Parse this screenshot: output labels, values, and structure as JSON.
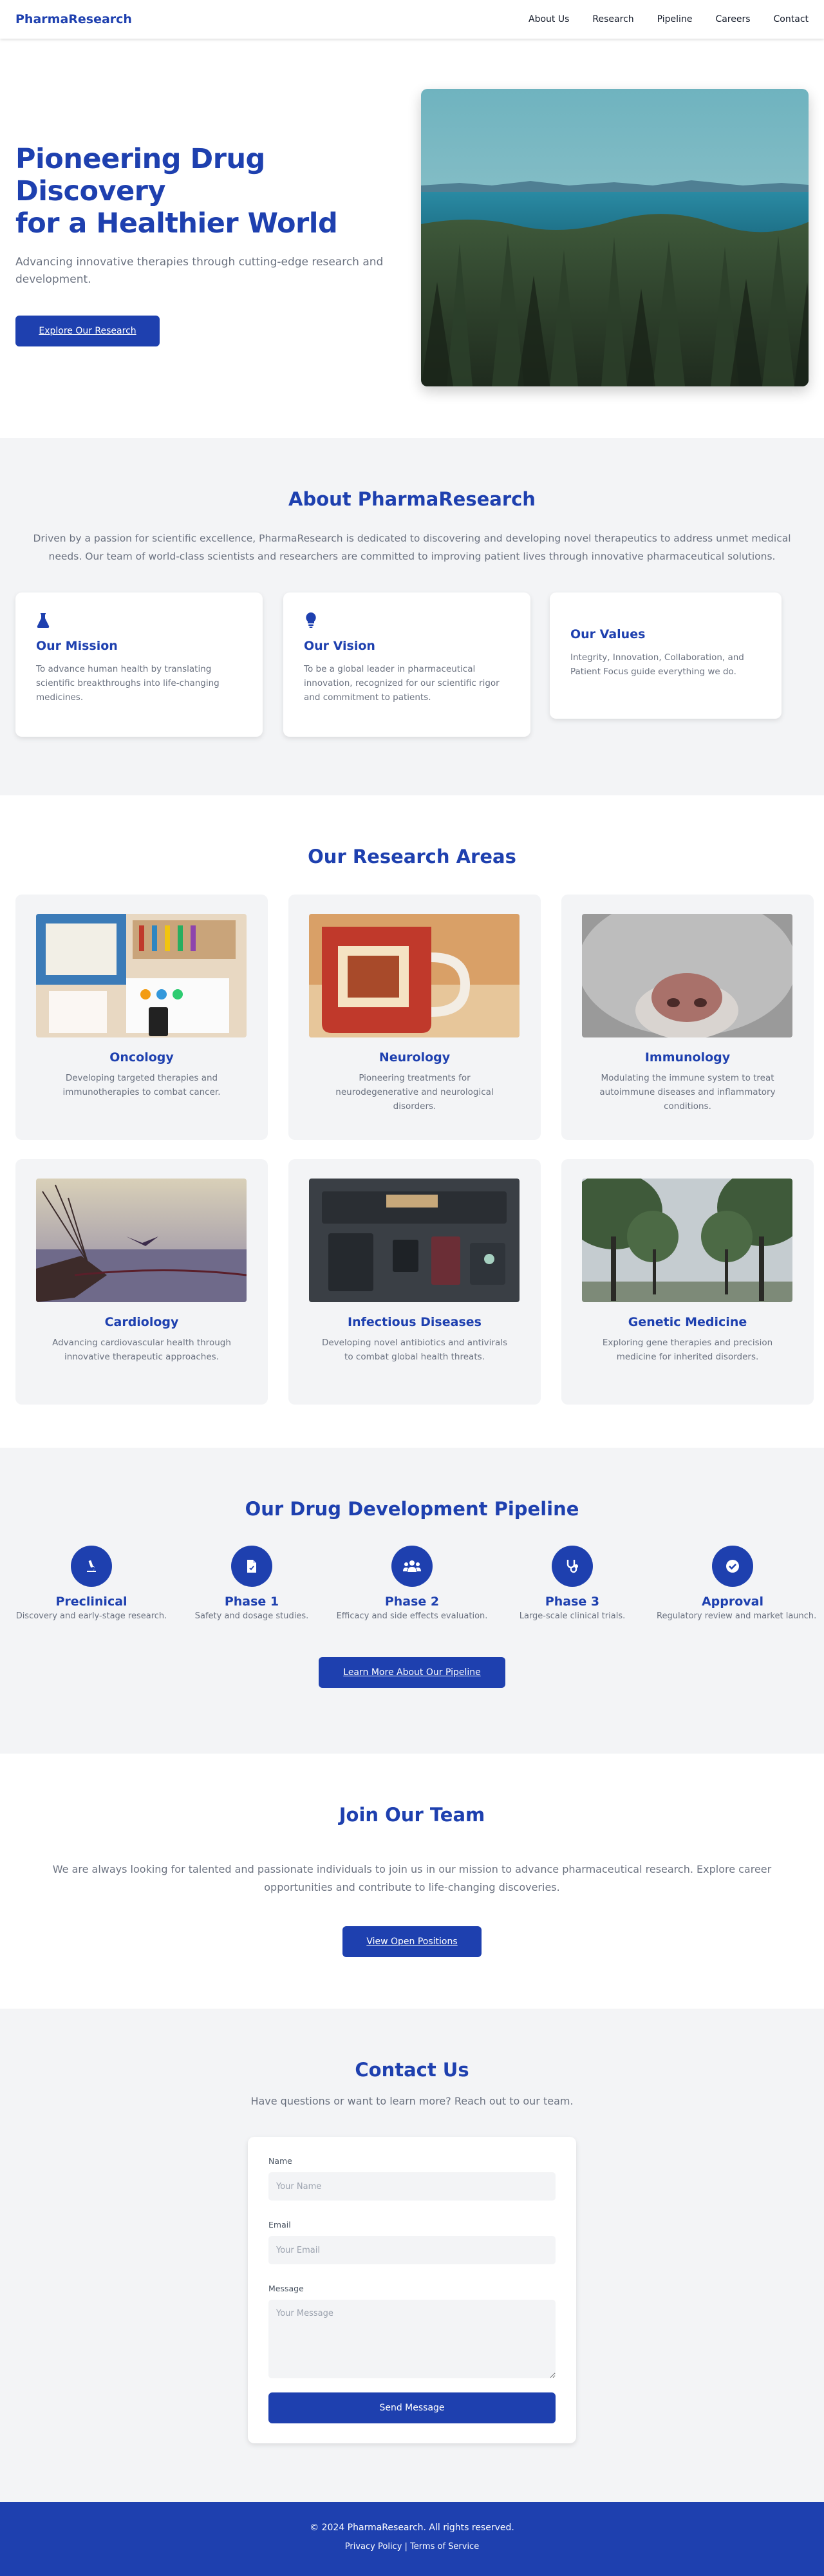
{
  "nav": {
    "brand": "PharmaResearch",
    "links": [
      "About Us",
      "Research",
      "Pipeline",
      "Careers",
      "Contact"
    ]
  },
  "hero": {
    "title_line1": "Pioneering Drug Discovery",
    "title_line2": "for a Healthier World",
    "subtitle": "Advancing innovative therapies through cutting-edge research and development.",
    "button": "Explore Our Research",
    "image_icon": "forest-lake-photo"
  },
  "about": {
    "title": "About PharmaResearch",
    "text": "Driven by a passion for scientific excellence, PharmaResearch is dedicated to discovering and developing novel therapeutics to address unmet medical needs. Our team of world-class scientists and researchers are committed to improving patient lives through innovative pharmaceutical solutions.",
    "cards": [
      {
        "title": "Our Mission",
        "text": "To advance human health by translating scientific breakthroughs into life-changing medicines.",
        "icon": "flask-icon"
      },
      {
        "title": "Our Vision",
        "text": "To be a global leader in pharmaceutical innovation, recognized for our scientific rigor and commitment to patients.",
        "icon": "lightbulb-icon"
      },
      {
        "title": "Our Values",
        "text": "Integrity, Innovation, Collaboration, and Patient Focus guide everything we do."
      }
    ]
  },
  "research": {
    "title": "Our Research Areas",
    "areas": [
      {
        "title": "Oncology",
        "text": "Developing targeted therapies and immunotherapies to combat cancer."
      },
      {
        "title": "Neurology",
        "text": "Pioneering treatments for neurodegenerative and neurological disorders."
      },
      {
        "title": "Immunology",
        "text": "Modulating the immune system to treat autoimmune diseases and inflammatory conditions."
      },
      {
        "title": "Cardiology",
        "text": "Advancing cardiovascular health through innovative therapeutic approaches."
      },
      {
        "title": "Infectious Diseases",
        "text": "Developing novel antibiotics and antivirals to combat global health threats."
      },
      {
        "title": "Genetic Medicine",
        "text": "Exploring gene therapies and precision medicine for inherited disorders."
      }
    ]
  },
  "pipeline": {
    "title": "Our Drug Development Pipeline",
    "steps": [
      {
        "title": "Preclinical",
        "text": "Discovery and early-stage research.",
        "icon": "microscope-icon"
      },
      {
        "title": "Phase 1",
        "text": "Safety and dosage studies.",
        "icon": "document-icon"
      },
      {
        "title": "Phase 2",
        "text": "Efficacy and side effects evaluation.",
        "icon": "people-icon"
      },
      {
        "title": "Phase 3",
        "text": "Large-scale clinical trials.",
        "icon": "stethoscope-icon"
      },
      {
        "title": "Approval",
        "text": "Regulatory review and market launch.",
        "icon": "check-circle-icon"
      }
    ],
    "button": "Learn More About Our Pipeline"
  },
  "careers": {
    "title": "Join Our Team",
    "text": "We are always looking for talented and passionate individuals to join us in our mission to advance pharmaceutical research. Explore career opportunities and contribute to life-changing discoveries.",
    "button": "View Open Positions"
  },
  "contact": {
    "title": "Contact Us",
    "subtitle": "Have questions or want to learn more? Reach out to our team.",
    "name_label": "Name",
    "name_placeholder": "Your Name",
    "email_label": "Email",
    "email_placeholder": "Your Email",
    "message_label": "Message",
    "message_placeholder": "Your Message",
    "submit": "Send Message"
  },
  "footer": {
    "copyright": "© 2024 PharmaResearch. All rights reserved.",
    "privacy": "Privacy Policy",
    "separator": "|",
    "terms": "Terms of Service"
  },
  "colors": {
    "brand": "#1e40af",
    "section_bg": "#f3f4f6",
    "muted_text": "#6b7280"
  }
}
